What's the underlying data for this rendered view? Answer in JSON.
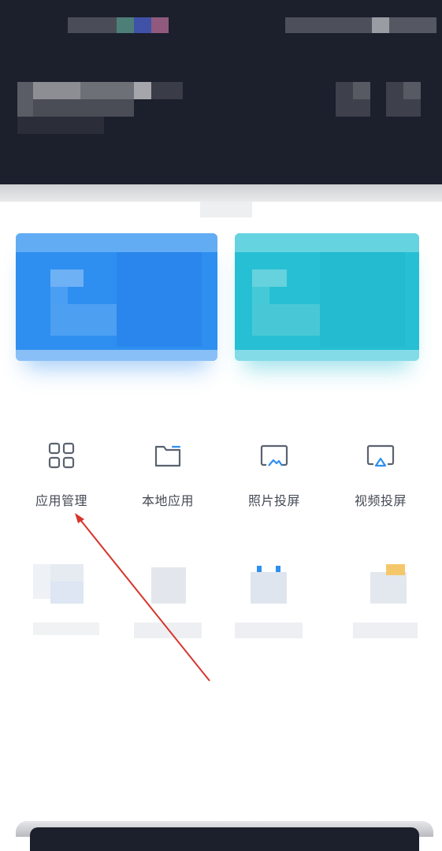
{
  "tools": [
    {
      "label": "应用管理",
      "icon": "grid-apps-icon"
    },
    {
      "label": "本地应用",
      "icon": "folder-icon"
    },
    {
      "label": "照片投屏",
      "icon": "photo-cast-icon"
    },
    {
      "label": "视频投屏",
      "icon": "video-cast-icon"
    }
  ],
  "colors": {
    "header_bg": "#1c1f2c",
    "card_blue": "#2e8ff0",
    "card_teal": "#27bfd3",
    "icon_stroke": "#5b6270",
    "cast_accent": "#2f8ff0",
    "annotation_arrow": "#d6352b"
  }
}
